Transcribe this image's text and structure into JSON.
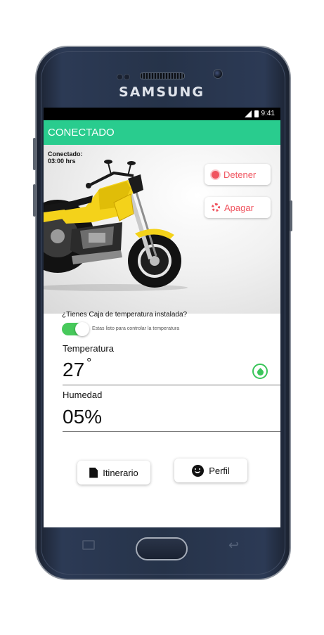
{
  "device": {
    "brand": "SAMSUNG"
  },
  "status_bar": {
    "time": "9:41"
  },
  "app_bar": {
    "title": "CONECTADO"
  },
  "connection": {
    "label": "Conectado:",
    "duration": "03:00 hrs"
  },
  "controls": {
    "stop_label": "Detener",
    "off_label": "Apagar"
  },
  "temperature_box": {
    "question": "¿Tienes Caja de temperatura instalada?",
    "toggle_on": true,
    "toggle_text": "Estas listo para controlar la temperatura"
  },
  "readings": {
    "temperature_label": "Temperatura",
    "temperature_value": "27",
    "temperature_unit": "°",
    "humidity_label": "Humedad",
    "humidity_value": "05%"
  },
  "actions": {
    "itinerary_label": "Itinerario",
    "profile_label": "Perfil"
  },
  "colors": {
    "accent": "#29cc8e",
    "alert": "#f0545f",
    "toggle": "#47c95b",
    "motorcycle": "#f4d21a"
  }
}
